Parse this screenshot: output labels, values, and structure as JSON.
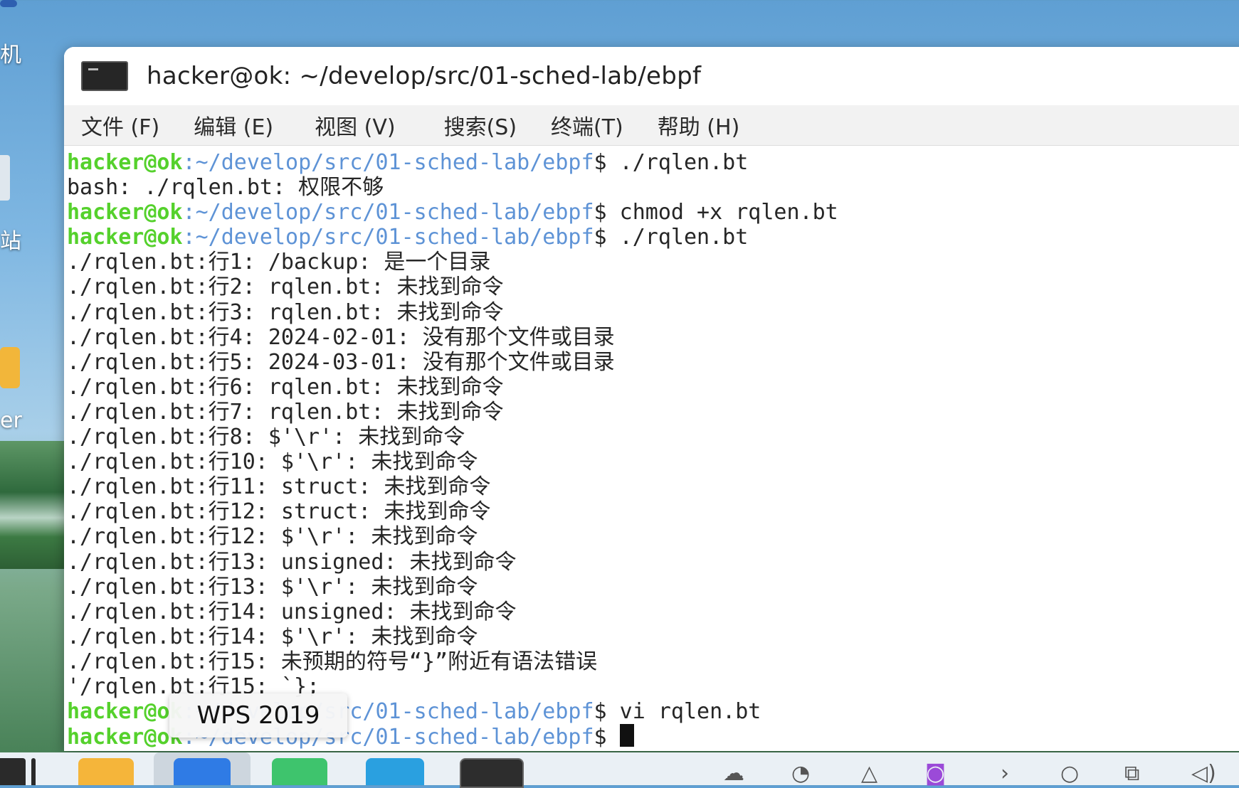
{
  "desktop": {
    "labels": [
      "机",
      "站",
      "er"
    ]
  },
  "window": {
    "title": "hacker@ok: ~/develop/src/01-sched-lab/ebpf",
    "menu": [
      "文件 (F)",
      "编辑 (E)",
      "视图 (V)",
      "搜索(S)",
      "终端(T)",
      "帮助 (H)"
    ]
  },
  "terminal": {
    "prompt_user": "hacker@ok",
    "prompt_path": ":~/develop/src/01-sched-lab/ebpf",
    "prompt_symbol": "$",
    "lines": [
      {
        "type": "prompt",
        "cmd": " ./rqlen.bt"
      },
      {
        "type": "out",
        "text": "bash: ./rqlen.bt: 权限不够"
      },
      {
        "type": "prompt",
        "cmd": " chmod +x rqlen.bt"
      },
      {
        "type": "prompt",
        "cmd": " ./rqlen.bt"
      },
      {
        "type": "out",
        "text": "./rqlen.bt:行1: /backup: 是一个目录"
      },
      {
        "type": "out",
        "text": "./rqlen.bt:行2: rqlen.bt: 未找到命令"
      },
      {
        "type": "out",
        "text": "./rqlen.bt:行3: rqlen.bt: 未找到命令"
      },
      {
        "type": "out",
        "text": "./rqlen.bt:行4: 2024-02-01: 没有那个文件或目录"
      },
      {
        "type": "out",
        "text": "./rqlen.bt:行5: 2024-03-01: 没有那个文件或目录"
      },
      {
        "type": "out",
        "text": "./rqlen.bt:行6: rqlen.bt: 未找到命令"
      },
      {
        "type": "out",
        "text": "./rqlen.bt:行7: rqlen.bt: 未找到命令"
      },
      {
        "type": "out",
        "text": "./rqlen.bt:行8: $'\\r': 未找到命令"
      },
      {
        "type": "out",
        "text": "./rqlen.bt:行10: $'\\r': 未找到命令"
      },
      {
        "type": "out",
        "text": "./rqlen.bt:行11: struct: 未找到命令"
      },
      {
        "type": "out",
        "text": "./rqlen.bt:行12: struct: 未找到命令"
      },
      {
        "type": "out",
        "text": "./rqlen.bt:行12: $'\\r': 未找到命令"
      },
      {
        "type": "out",
        "text": "./rqlen.bt:行13: unsigned: 未找到命令"
      },
      {
        "type": "out",
        "text": "./rqlen.bt:行13: $'\\r': 未找到命令"
      },
      {
        "type": "out",
        "text": "./rqlen.bt:行14: unsigned: 未找到命令"
      },
      {
        "type": "out",
        "text": "./rqlen.bt:行14: $'\\r': 未找到命令"
      },
      {
        "type": "out",
        "text": "./rqlen.bt:行15: 未预期的符号“}”附近有语法错误"
      },
      {
        "type": "out",
        "text": "'/rqlen.bt:行15: `};"
      },
      {
        "type": "prompt",
        "cmd": " vi rqlen.bt"
      },
      {
        "type": "prompt_cursor",
        "cmd": " "
      }
    ]
  },
  "tooltip": {
    "text": "WPS 2019"
  },
  "taskbar": {
    "apps": [
      "app-store-icon",
      "wps-icon",
      "chat-icon",
      "layers-icon",
      "terminal-icon"
    ],
    "tray": [
      "cloud-icon",
      "headset-icon",
      "network-icon",
      "record-icon",
      "chevron-icon",
      "circle-icon",
      "clipboard-icon",
      "volume-icon"
    ]
  }
}
